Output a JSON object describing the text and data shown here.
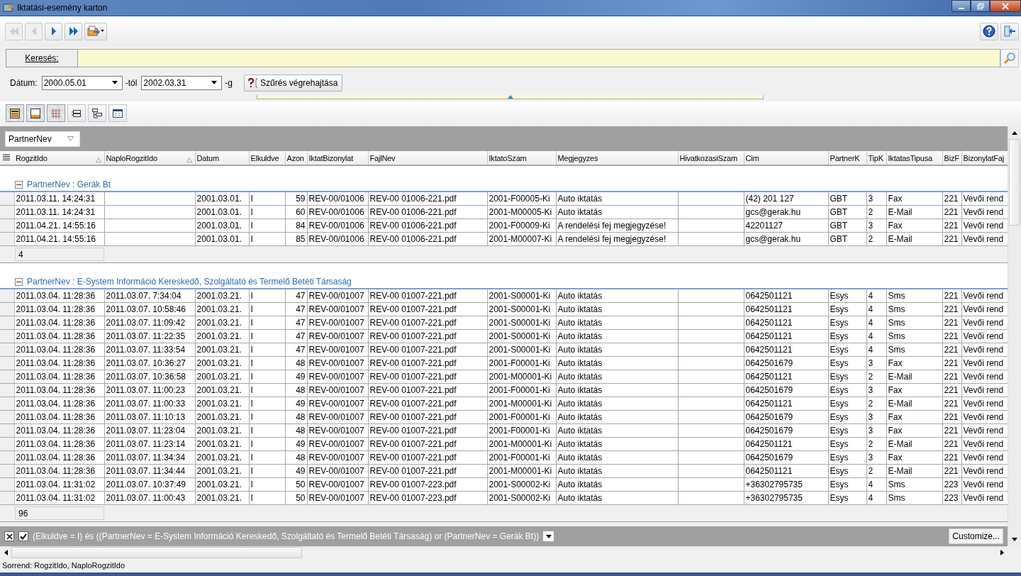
{
  "window": {
    "title": "Iktatási-esemény karton"
  },
  "nav_buttons": [
    {
      "kind": "first",
      "disabled": true
    },
    {
      "kind": "prev",
      "disabled": true
    },
    {
      "kind": "next",
      "disabled": false
    },
    {
      "kind": "last",
      "disabled": false
    },
    {
      "kind": "export",
      "disabled": false
    }
  ],
  "search": {
    "label": "Keresés:"
  },
  "date_filter": {
    "label": "Dátum:",
    "from": "2000.05.01",
    "from_suffix": "-tól",
    "to": "2002.03.31",
    "to_suffix": "-g",
    "apply_button": "Szűrés végrehajtása"
  },
  "view_buttons": [
    {
      "kind": "group-panel",
      "selected": true
    },
    {
      "kind": "footer",
      "selected": true
    },
    {
      "kind": "grid-lines",
      "selected": true
    },
    {
      "kind": "bands",
      "selected": false
    },
    {
      "kind": "tree",
      "selected": false
    },
    {
      "kind": "card",
      "selected": false
    }
  ],
  "group_by": [
    "PartnerNev"
  ],
  "columns": [
    {
      "label": "RogzitIdo",
      "sorted": true
    },
    {
      "label": "NaploRogzitIdo",
      "sorted": true
    },
    {
      "label": "Datum",
      "sorted": false
    },
    {
      "label": "Elkuldve",
      "sorted": false
    },
    {
      "label": "Azon",
      "sorted": false
    },
    {
      "label": "IktatBizonylat",
      "sorted": false
    },
    {
      "label": "FajlNev",
      "sorted": false
    },
    {
      "label": "IktatoSzam",
      "sorted": false
    },
    {
      "label": "Megjegyzes",
      "sorted": false
    },
    {
      "label": "HivatkozasiSzam",
      "sorted": false
    },
    {
      "label": "Cim",
      "sorted": false
    },
    {
      "label": "PartnerK",
      "sorted": false
    },
    {
      "label": "TipK",
      "sorted": false
    },
    {
      "label": "IktatasTipusa",
      "sorted": false
    },
    {
      "label": "BizF",
      "sorted": false
    },
    {
      "label": "BizonylatFaj",
      "sorted": false
    }
  ],
  "groups": [
    {
      "title": "PartnerNev : Gerák Bt",
      "expanded": true,
      "count": "4",
      "rows": [
        [
          "2011.03.11. 14:24:31",
          "",
          "2001.03.01.",
          "I",
          "59",
          "REV-00/01006",
          "REV-00 01006-221.pdf",
          "2001-F00005-Ki",
          "Auto iktatás",
          "",
          "(42) 201 127",
          "GBT",
          "3",
          "Fax",
          "221",
          "Vevői rend"
        ],
        [
          "2011.03.11. 14:24:31",
          "",
          "2001.03.01.",
          "I",
          "60",
          "REV-00/01006",
          "REV-00 01006-221.pdf",
          "2001-M00005-Ki",
          "Auto iktatás",
          "",
          "gcs@gerak.hu",
          "GBT",
          "2",
          "E-Mail",
          "221",
          "Vevői rend"
        ],
        [
          "2011.04.21. 14:55:16",
          "",
          "2001.03.01.",
          "I",
          "84",
          "REV-00/01006",
          "REV-00 01006-221.pdf",
          "2001-F00009-Ki",
          "A rendelési fej megjegyzése!",
          "",
          "42201127",
          "GBT",
          "3",
          "Fax",
          "221",
          "Vevői rend"
        ],
        [
          "2011.04.21. 14:55:16",
          "",
          "2001.03.01.",
          "I",
          "85",
          "REV-00/01006",
          "REV-00 01006-221.pdf",
          "2001-M00007-Ki",
          "A rendelési fej megjegyzése!",
          "",
          "gcs@gerak.hu",
          "GBT",
          "2",
          "E-Mail",
          "221",
          "Vevői rend"
        ]
      ]
    },
    {
      "title": "PartnerNev : E-System Információ Kereskedő, Szolgáltató és Termelő Betéti Társaság",
      "expanded": true,
      "count": "96",
      "rows": [
        [
          "2011.03.04. 11:28:36",
          "2011.03.07. 7:34:04",
          "2001.03.21.",
          "I",
          "47",
          "REV-00/01007",
          "REV-00 01007-221.pdf",
          "2001-S00001-Ki",
          "Auto iktatás",
          "",
          "0642501121",
          "Esys",
          "4",
          "Sms",
          "221",
          "Vevői rend"
        ],
        [
          "2011.03.04. 11:28:36",
          "2011.03.07. 10:58:46",
          "2001.03.21.",
          "I",
          "47",
          "REV-00/01007",
          "REV-00 01007-221.pdf",
          "2001-S00001-Ki",
          "Auto iktatás",
          "",
          "0642501121",
          "Esys",
          "4",
          "Sms",
          "221",
          "Vevői rend"
        ],
        [
          "2011.03.04. 11:28:36",
          "2011.03.07. 11:09:42",
          "2001.03.21.",
          "I",
          "47",
          "REV-00/01007",
          "REV-00 01007-221.pdf",
          "2001-S00001-Ki",
          "Auto iktatás",
          "",
          "0642501121",
          "Esys",
          "4",
          "Sms",
          "221",
          "Vevői rend"
        ],
        [
          "2011.03.04. 11:28:36",
          "2011.03.07. 11:22:35",
          "2001.03.21.",
          "I",
          "47",
          "REV-00/01007",
          "REV-00 01007-221.pdf",
          "2001-S00001-Ki",
          "Auto iktatás",
          "",
          "0642501121",
          "Esys",
          "4",
          "Sms",
          "221",
          "Vevői rend"
        ],
        [
          "2011.03.04. 11:28:36",
          "2011.03.07. 11:33:54",
          "2001.03.21.",
          "I",
          "47",
          "REV-00/01007",
          "REV-00 01007-221.pdf",
          "2001-S00001-Ki",
          "Auto iktatás",
          "",
          "0642501121",
          "Esys",
          "4",
          "Sms",
          "221",
          "Vevői rend"
        ],
        [
          "2011.03.04. 11:28:36",
          "2011.03.07. 10:36:27",
          "2001.03.21.",
          "I",
          "48",
          "REV-00/01007",
          "REV-00 01007-221.pdf",
          "2001-F00001-Ki",
          "Auto iktatás",
          "",
          "0642501679",
          "Esys",
          "3",
          "Fax",
          "221",
          "Vevői rend"
        ],
        [
          "2011.03.04. 11:28:36",
          "2011.03.07. 10:36:58",
          "2001.03.21.",
          "I",
          "49",
          "REV-00/01007",
          "REV-00 01007-221.pdf",
          "2001-M00001-Ki",
          "Auto iktatás",
          "",
          "0642501121",
          "Esys",
          "2",
          "E-Mail",
          "221",
          "Vevői rend"
        ],
        [
          "2011.03.04. 11:28:36",
          "2011.03.07. 11:00:23",
          "2001.03.21.",
          "I",
          "48",
          "REV-00/01007",
          "REV-00 01007-221.pdf",
          "2001-F00001-Ki",
          "Auto iktatás",
          "",
          "0642501679",
          "Esys",
          "3",
          "Fax",
          "221",
          "Vevői rend"
        ],
        [
          "2011.03.04. 11:28:36",
          "2011.03.07. 11:00:33",
          "2001.03.21.",
          "I",
          "49",
          "REV-00/01007",
          "REV-00 01007-221.pdf",
          "2001-M00001-Ki",
          "Auto iktatás",
          "",
          "0642501121",
          "Esys",
          "2",
          "E-Mail",
          "221",
          "Vevői rend"
        ],
        [
          "2011.03.04. 11:28:36",
          "2011.03.07. 11:10:13",
          "2001.03.21.",
          "I",
          "48",
          "REV-00/01007",
          "REV-00 01007-221.pdf",
          "2001-F00001-Ki",
          "Auto iktatás",
          "",
          "0642501679",
          "Esys",
          "3",
          "Fax",
          "221",
          "Vevői rend"
        ],
        [
          "2011.03.04. 11:28:36",
          "2011.03.07. 11:23:04",
          "2001.03.21.",
          "I",
          "48",
          "REV-00/01007",
          "REV-00 01007-221.pdf",
          "2001-F00001-Ki",
          "Auto iktatás",
          "",
          "0642501679",
          "Esys",
          "3",
          "Fax",
          "221",
          "Vevői rend"
        ],
        [
          "2011.03.04. 11:28:36",
          "2011.03.07. 11:23:14",
          "2001.03.21.",
          "I",
          "49",
          "REV-00/01007",
          "REV-00 01007-221.pdf",
          "2001-M00001-Ki",
          "Auto iktatás",
          "",
          "0642501121",
          "Esys",
          "2",
          "E-Mail",
          "221",
          "Vevői rend"
        ],
        [
          "2011.03.04. 11:28:36",
          "2011.03.07. 11:34:34",
          "2001.03.21.",
          "I",
          "48",
          "REV-00/01007",
          "REV-00 01007-221.pdf",
          "2001-F00001-Ki",
          "Auto iktatás",
          "",
          "0642501679",
          "Esys",
          "3",
          "Fax",
          "221",
          "Vevői rend"
        ],
        [
          "2011.03.04. 11:28:36",
          "2011.03.07. 11:34:44",
          "2001.03.21.",
          "I",
          "49",
          "REV-00/01007",
          "REV-00 01007-221.pdf",
          "2001-M00001-Ki",
          "Auto iktatás",
          "",
          "0642501121",
          "Esys",
          "2",
          "E-Mail",
          "221",
          "Vevői rend"
        ],
        [
          "2011.03.04. 11:31:02",
          "2011.03.07. 10:37:49",
          "2001.03.21.",
          "I",
          "50",
          "REV-00/01007",
          "REV-00 01007-223.pdf",
          "2001-S00002-Ki",
          "Auto iktatás",
          "",
          "+36302795735",
          "Esys",
          "4",
          "Sms",
          "223",
          "Vevői rend"
        ],
        [
          "2011.03.04. 11:31:02",
          "2011.03.07. 11:00:43",
          "2001.03.21.",
          "I",
          "50",
          "REV-00/01007",
          "REV-00 01007-223.pdf",
          "2001-S00002-Ki",
          "Auto iktatás",
          "",
          "+36302795735",
          "Esys",
          "4",
          "Sms",
          "223",
          "Vevői rend"
        ]
      ]
    }
  ],
  "filter": {
    "checked": true,
    "text": "(Elkuldve = I) és ((PartnerNev = E-System Információ Kereskedő, Szolgáltató és Termelő Betéti Társaság) or (PartnerNev = Gerák Bt))",
    "customize_button": "Customize..."
  },
  "status_bar": "Sorrend: RogzitIdo, NaploRogzitIdo"
}
